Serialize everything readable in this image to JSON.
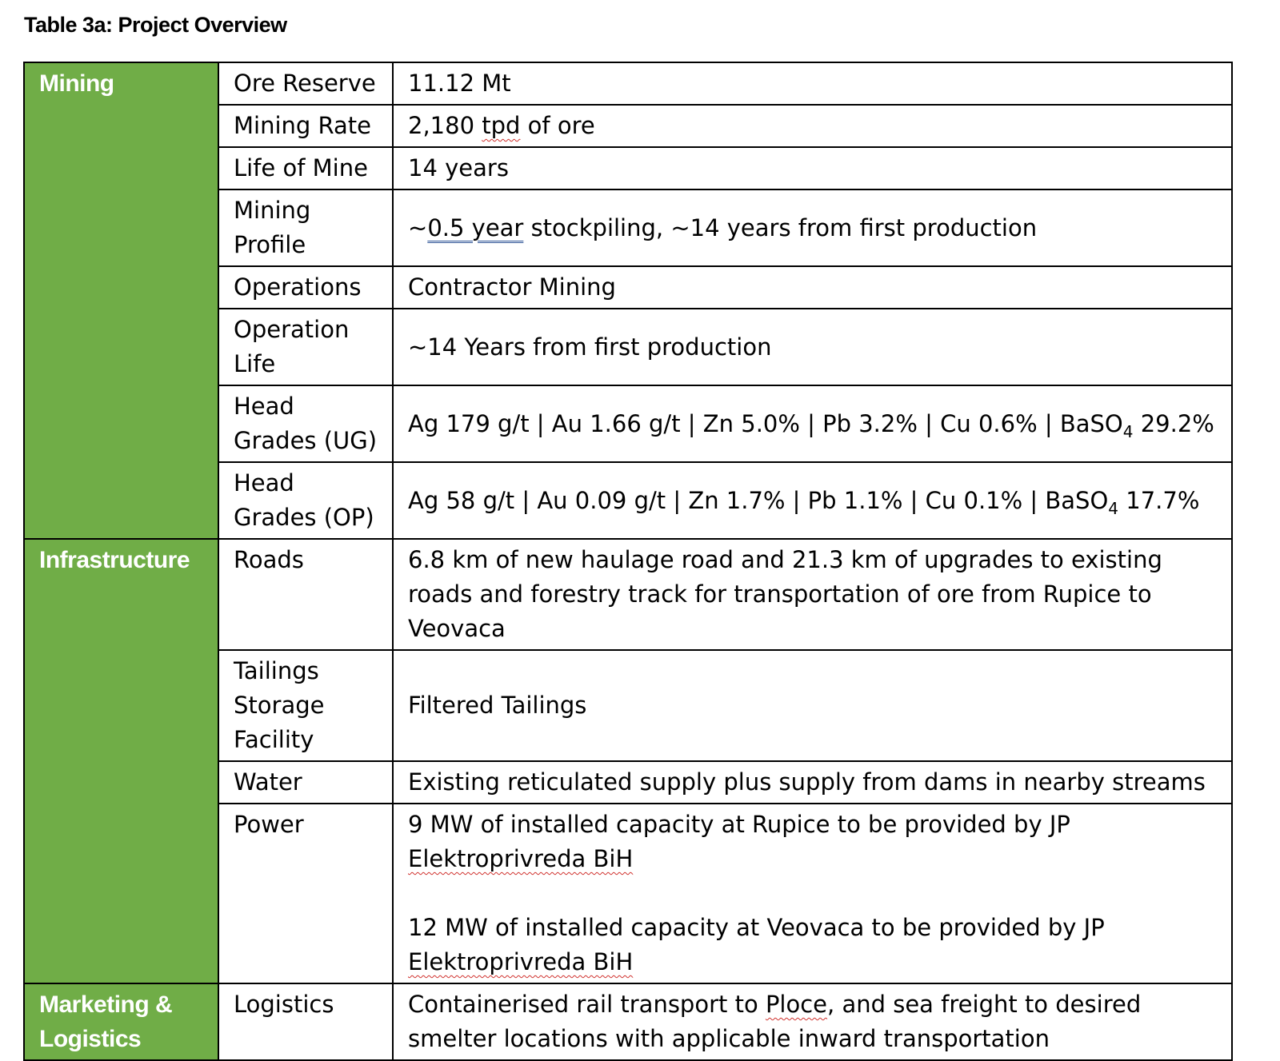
{
  "caption": "Table 3a: Project Overview",
  "sections": {
    "mining": {
      "label": "Mining",
      "rows": [
        {
          "param": "Ore Reserve",
          "value": "11.12 Mt"
        },
        {
          "param": "Mining Rate",
          "value_pre": "2,180 ",
          "value_mark": "tpd",
          "value_post": " of ore"
        },
        {
          "param": "Life of Mine",
          "value": "14 years"
        },
        {
          "param": "Mining Profile",
          "value_pre": "~",
          "value_mark": "0.5 year",
          "value_post": " stockpiling, ~14 years from first production"
        },
        {
          "param": "Operations",
          "value": "Contractor Mining"
        },
        {
          "param": "Operation Life",
          "value": "~14 Years from first production"
        },
        {
          "param": "Head Grades (UG)",
          "value_pre": "Ag 179 g/t | Au 1.66 g/t | Zn 5.0% | Pb 3.2% | Cu 0.6% | BaSO",
          "value_sub": "4",
          "value_post": " 29.2%"
        },
        {
          "param": "Head Grades (OP)",
          "value_pre": "Ag 58 g/t | Au 0.09 g/t | Zn 1.7% | Pb 1.1% | Cu 0.1% | BaSO",
          "value_sub": "4",
          "value_post": " 17.7%"
        }
      ]
    },
    "infrastructure": {
      "label": "Infrastructure",
      "rows": [
        {
          "param": "Roads",
          "value": "6.8 km of new haulage road and 21.3 km of upgrades to existing roads and forestry track for transportation of ore from Rupice to Veovaca"
        },
        {
          "param": "Tailings Storage Facility",
          "value": "Filtered Tailings"
        },
        {
          "param": "Water",
          "value": "Existing reticulated supply plus supply from dams in nearby streams"
        },
        {
          "param": "Power",
          "value_a_pre": "9 MW of installed capacity at Rupice to be provided by JP ",
          "value_a_mark": "Elektroprivreda BiH",
          "value_b_pre": "12 MW of installed capacity at Veovaca to be provided by JP ",
          "value_b_mark": "Elektroprivreda BiH"
        }
      ]
    },
    "marketing": {
      "label": "Marketing & Logistics",
      "rows": [
        {
          "param": "Logistics",
          "value_pre": "Containerised rail transport to ",
          "value_mark": "Ploce",
          "value_post": ", and sea freight to desired smelter locations with applicable inward transportation"
        }
      ]
    }
  }
}
